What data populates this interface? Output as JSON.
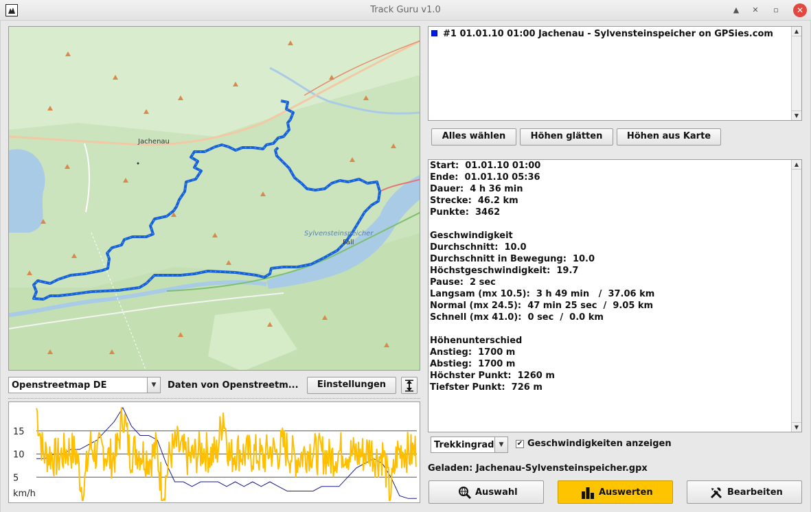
{
  "window": {
    "title": "Track Guru v1.0",
    "controls": [
      "▲",
      "✕",
      "▫",
      "✕"
    ]
  },
  "map": {
    "labels": {
      "town": "Jachenau",
      "lake": "Sylvensteinspeicher",
      "fall": "Fall"
    },
    "track_color": "#1a5fd8",
    "provider_select": "Openstreetmap DE",
    "attribution": "Daten von Openstreetm...",
    "settings_button": "Einstellungen",
    "resize_icon": "resize-vertical-icon"
  },
  "chart_data": {
    "type": "line",
    "y_ticks": [
      "15",
      "10",
      "5"
    ],
    "ylabel": "km/h",
    "ylim": [
      0,
      20
    ],
    "series": [
      {
        "color": "#ffbf00",
        "values": [
          20,
          10,
          10,
          9,
          10,
          11,
          10,
          1,
          12,
          10,
          11,
          9,
          10,
          19,
          10,
          11,
          10,
          9,
          11,
          1,
          10,
          12,
          10,
          9,
          10,
          11,
          10,
          10,
          19,
          9,
          11,
          10,
          10,
          10,
          9,
          11,
          10,
          12,
          10,
          9,
          10,
          11,
          10,
          10,
          9,
          10,
          11,
          10,
          10,
          10,
          11,
          9,
          10,
          1,
          10,
          11,
          10,
          11
        ]
      },
      {
        "color": "#1a1a8a",
        "values": [
          9,
          9,
          10,
          10,
          11,
          11,
          12,
          13,
          15,
          17,
          20,
          16,
          14,
          14,
          13,
          8,
          4,
          4,
          3,
          4,
          4,
          4,
          3,
          4,
          3,
          4,
          3,
          4,
          3,
          2,
          2,
          2,
          2,
          3,
          3,
          3,
          5,
          7,
          8,
          9,
          8,
          5,
          1,
          0.4,
          0.4
        ]
      }
    ]
  },
  "tracks": [
    {
      "label": "#1  01.01.10 01:00  Jachenau - Sylvensteinspeicher on GPSies.com",
      "color": "#0019f0"
    }
  ],
  "actions": {
    "select_all": "Alles wählen",
    "smooth_heights": "Höhen glätten",
    "heights_from_map": "Höhen aus Karte"
  },
  "stats": [
    "Start:  01.01.10 01:00",
    "Ende:  01.01.10 05:36",
    "Dauer:  4 h 36 min",
    "Strecke:  46.2 km",
    "Punkte:  3462",
    "",
    "Geschwindigkeit",
    "Durchschnitt:  10.0",
    "Durchschnitt in Bewegung:  10.0",
    "Höchstgeschwindigkeit:  19.7",
    "Pause:  2 sec",
    "Langsam (mx 10.5):  3 h 49 min   /  37.06 km",
    "Normal (mx 24.5):  47 min 25 sec  /  9.05 km",
    "Schnell (mx 41.0):  0 sec  /  0.0 km",
    "",
    "Höhenunterschied",
    "Anstieg:  1700 m",
    "Abstieg:  1700 m",
    "Höchster Punkt:  1260 m",
    "Tiefster Punkt:  726 m"
  ],
  "options": {
    "profile_select": "Trekkingrad",
    "show_speeds_label": "Geschwindigkeiten anzeigen",
    "show_speeds_checked": "✔"
  },
  "loaded": "Geladen: Jachenau-Sylvensteinspeicher.gpx",
  "bottom_buttons": {
    "select": "Auswahl",
    "evaluate": "Auswerten",
    "edit": "Bearbeiten"
  }
}
